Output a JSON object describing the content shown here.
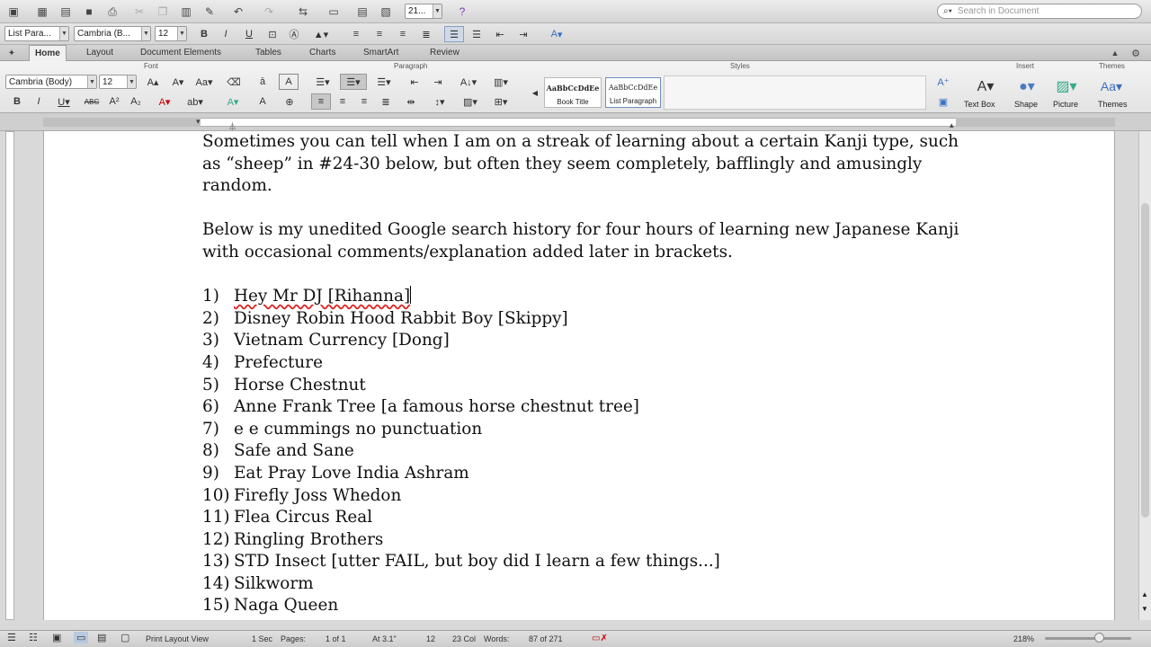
{
  "toolbar": {
    "style_field": "List Para...",
    "font_field": "Cambria (B...",
    "size_field": "12",
    "zoom_field": "21...",
    "search_placeholder": "Search in Document",
    "buttons": [
      "new-icon",
      "template-icon",
      "open-icon",
      "save-icon",
      "print-icon",
      "cut-icon",
      "copy-icon",
      "paste-icon",
      "format-painter-icon",
      "undo-icon",
      "redo-icon",
      "sidebar-icon",
      "view-icon",
      "gallery-icon",
      "media-icon",
      "help-icon"
    ]
  },
  "format_bar": {
    "bold": "B",
    "italic": "I",
    "underline": "U",
    "text_color_label": "A"
  },
  "tabs": [
    "Home",
    "Layout",
    "Document Elements",
    "Tables",
    "Charts",
    "SmartArt",
    "Review"
  ],
  "ribbon": {
    "groups": {
      "font": "Font",
      "paragraph": "Paragraph",
      "styles": "Styles",
      "insert": "Insert",
      "themes": "Themes"
    },
    "font_name": "Cambria (Body)",
    "font_size": "12",
    "styles": [
      {
        "preview": "AaBbCcDdEe",
        "name": "Book Title"
      },
      {
        "preview": "AaBbCcDdEe",
        "name": "List Paragraph"
      }
    ],
    "insert_items": [
      "Text Box",
      "Shape",
      "Picture"
    ],
    "themes_label": "Themes"
  },
  "document": {
    "intro": [
      "Sometimes you can tell when I am on a streak of learning about a certain Kanji type, such as “sheep” in #24-30 below, but often they seem completely, bafflingly and amusingly random.",
      "Below is my unedited Google search history for four hours of learning new Japanese Kanji with occasional comments/explanation added later in brackets."
    ],
    "items": [
      {
        "num": "1)",
        "text": "Hey Mr DJ [Rihanna]"
      },
      {
        "num": "2)",
        "text": "Disney Robin Hood Rabbit Boy [Skippy]"
      },
      {
        "num": "3)",
        "text": "Vietnam Currency [Dong]"
      },
      {
        "num": "4)",
        "text": "Prefecture"
      },
      {
        "num": "5)",
        "text": "Horse Chestnut"
      },
      {
        "num": "6)",
        "text": "Anne Frank Tree [a famous horse chestnut tree]"
      },
      {
        "num": "7)",
        "text": "e e cummings no punctuation"
      },
      {
        "num": "8)",
        "text": "Safe and Sane"
      },
      {
        "num": "9)",
        "text": "Eat Pray Love India Ashram"
      },
      {
        "num": "10)",
        "text": "Firefly Joss Whedon"
      },
      {
        "num": "11)",
        "text": "Flea Circus Real"
      },
      {
        "num": "12)",
        "text": "Ringling Brothers"
      },
      {
        "num": "13)",
        "text": "STD Insect [utter FAIL, but boy did I learn a few things...]"
      },
      {
        "num": "14)",
        "text": "Silkworm"
      },
      {
        "num": "15)",
        "text": "Naga Queen"
      }
    ]
  },
  "statusbar": {
    "view": "Print Layout View",
    "sec": "1 Sec",
    "pages_label": "Pages:",
    "pages_value": "1 of 1",
    "at": "At 3.1\"",
    "ln": "12",
    "col": "23 Col",
    "words_label": "Words:",
    "words_value": "87 of 271",
    "zoom": "218%"
  }
}
